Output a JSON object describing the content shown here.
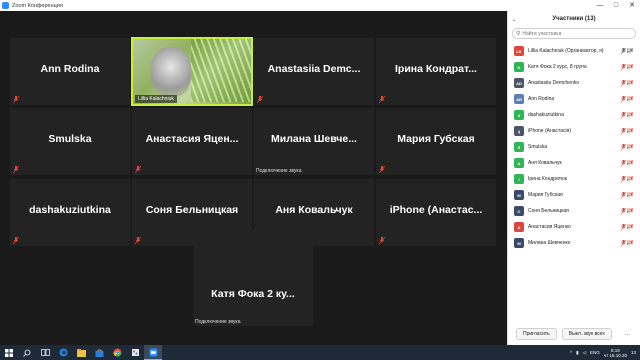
{
  "window": {
    "title": "Zoom Конференция",
    "controls": [
      "—",
      "□",
      "✕"
    ]
  },
  "gallery": {
    "tiles": [
      {
        "name": "Ann Rodina"
      },
      {
        "name": "Lillia Kalachniuk",
        "video": true
      },
      {
        "name": "Anastasiia Demc..."
      },
      {
        "name": "Ірина Кондрат..."
      },
      {
        "name": "Smulska"
      },
      {
        "name": "Анастасия Яцен..."
      },
      {
        "name": "Милана Шевче...",
        "status": "Подключение звука"
      },
      {
        "name": "Мария Губская"
      },
      {
        "name": "dashakuziutkina"
      },
      {
        "name": "Соня Бельницкая"
      },
      {
        "name": "Аня Ковальчук"
      },
      {
        "name": "iPhone (Анастас..."
      }
    ],
    "big_tile": {
      "name": "Катя Фока 2 ку...",
      "status": "Подключение звука"
    }
  },
  "participants": {
    "title": "Участники (13)",
    "search_placeholder": "Найти участника",
    "list": [
      {
        "initials": "LK",
        "color": "#d9483b",
        "name": "Lillia Kalachniuk (Организатор, я)"
      },
      {
        "initials": "K",
        "color": "#2fb456",
        "name": "Катя Фока 2 курс, 8 група"
      },
      {
        "initials": "AD",
        "color": "#4a5568",
        "name": "Anastasiia Demchenko"
      },
      {
        "initials": "AR",
        "color": "#5b7fb5",
        "name": "Ann Rodina"
      },
      {
        "initials": "d",
        "color": "#2fb456",
        "name": "dashakuziutkina"
      },
      {
        "initials": "i(",
        "color": "#4a5568",
        "name": "iPhone (Анастасія)"
      },
      {
        "initials": "S",
        "color": "#2fb456",
        "name": "Smulska"
      },
      {
        "initials": "A",
        "color": "#2fb456",
        "name": "Аня Ковальчук"
      },
      {
        "initials": "I",
        "color": "#2fb456",
        "name": "Ірина Кондратюк"
      },
      {
        "initials": "M",
        "color": "#3b4a6b",
        "name": "Мария Губская"
      },
      {
        "initials": "C",
        "color": "#3b4a6b",
        "name": "Соня Бельницкая"
      },
      {
        "initials": "A",
        "color": "#d9483b",
        "name": "Анастасия Яценко"
      },
      {
        "initials": "M",
        "color": "#3b4a6b",
        "name": "Милана Шевченко"
      }
    ],
    "invite_label": "Пригласить",
    "mute_all_label": "Выкл. звук всех",
    "more_label": "..."
  },
  "taskbar": {
    "lang": "ENG",
    "time": "8:19",
    "date": "чт 15.10.20",
    "notification_count": "13"
  },
  "colors": {
    "accent": "#c8ee3c",
    "muted": "#e0473a"
  }
}
